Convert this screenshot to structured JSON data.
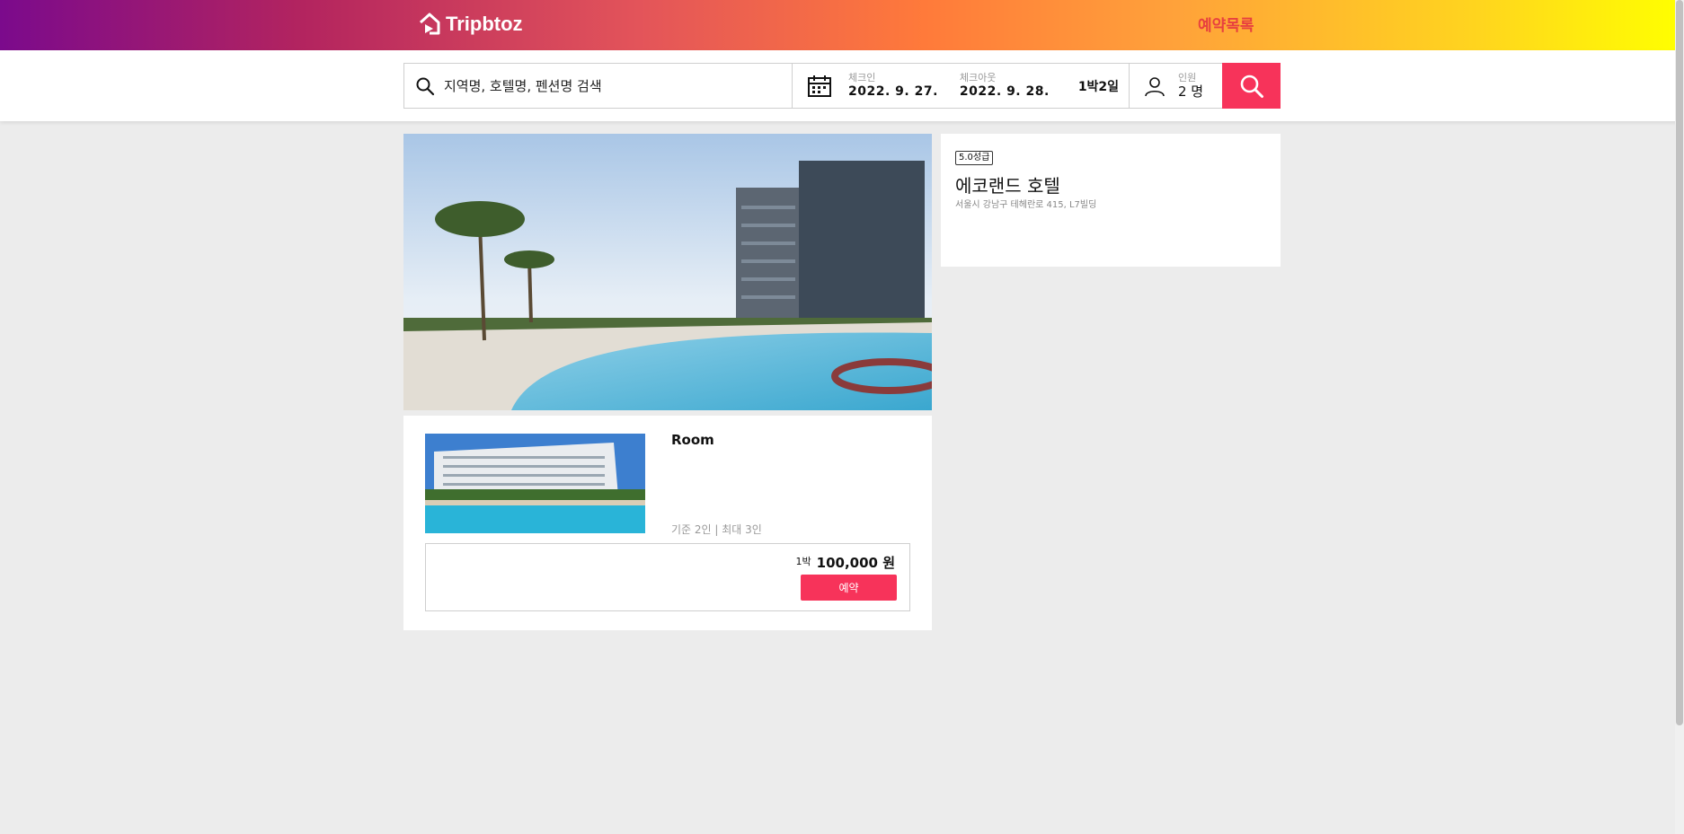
{
  "header": {
    "brand": "Tripbtoz",
    "reservations_link": "예약목록"
  },
  "search": {
    "query_placeholder": "지역명, 호텔명, 펜션명 검색",
    "checkin_label": "체크인",
    "checkin_value": "2022. 9. 27.",
    "checkout_label": "체크아웃",
    "checkout_value": "2022. 9. 28.",
    "nights": "1박2일",
    "guests_label": "인원",
    "guests_value": "2 명"
  },
  "hotel": {
    "grade": "5.0성급",
    "name": "에코랜드 호텔",
    "address": "서울시 강남구 테헤란로 415, L7빌딩"
  },
  "room": {
    "title": "Room",
    "capacity": "기준 2인 | 최대 3인",
    "night_label": "1박",
    "price": "100,000 원",
    "book_label": "예약"
  },
  "colors": {
    "accent": "#f7335a",
    "reservations_link": "#e8403f"
  }
}
